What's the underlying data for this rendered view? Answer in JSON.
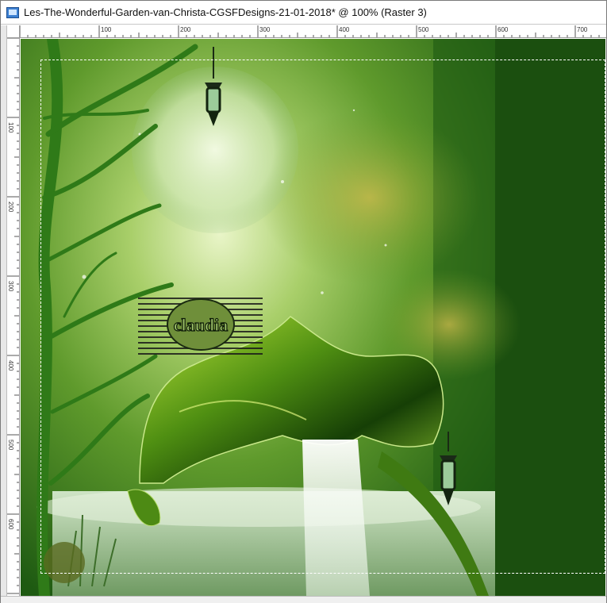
{
  "window": {
    "title": "Les-The-Wonderful-Garden-van-Christa-CGSFDesigns-21-01-2018* @ 100% (Raster 3)",
    "icon": "image-document-icon"
  },
  "ruler": {
    "horizontal_labels": [
      "100",
      "200",
      "300",
      "400",
      "500",
      "600",
      "700"
    ],
    "vertical_labels": [
      "100",
      "200",
      "300",
      "400",
      "500",
      "600"
    ]
  },
  "canvas": {
    "watermark_text": "claudia",
    "background_color": "#1b4f0f",
    "accent_color": "#7fb52a"
  }
}
